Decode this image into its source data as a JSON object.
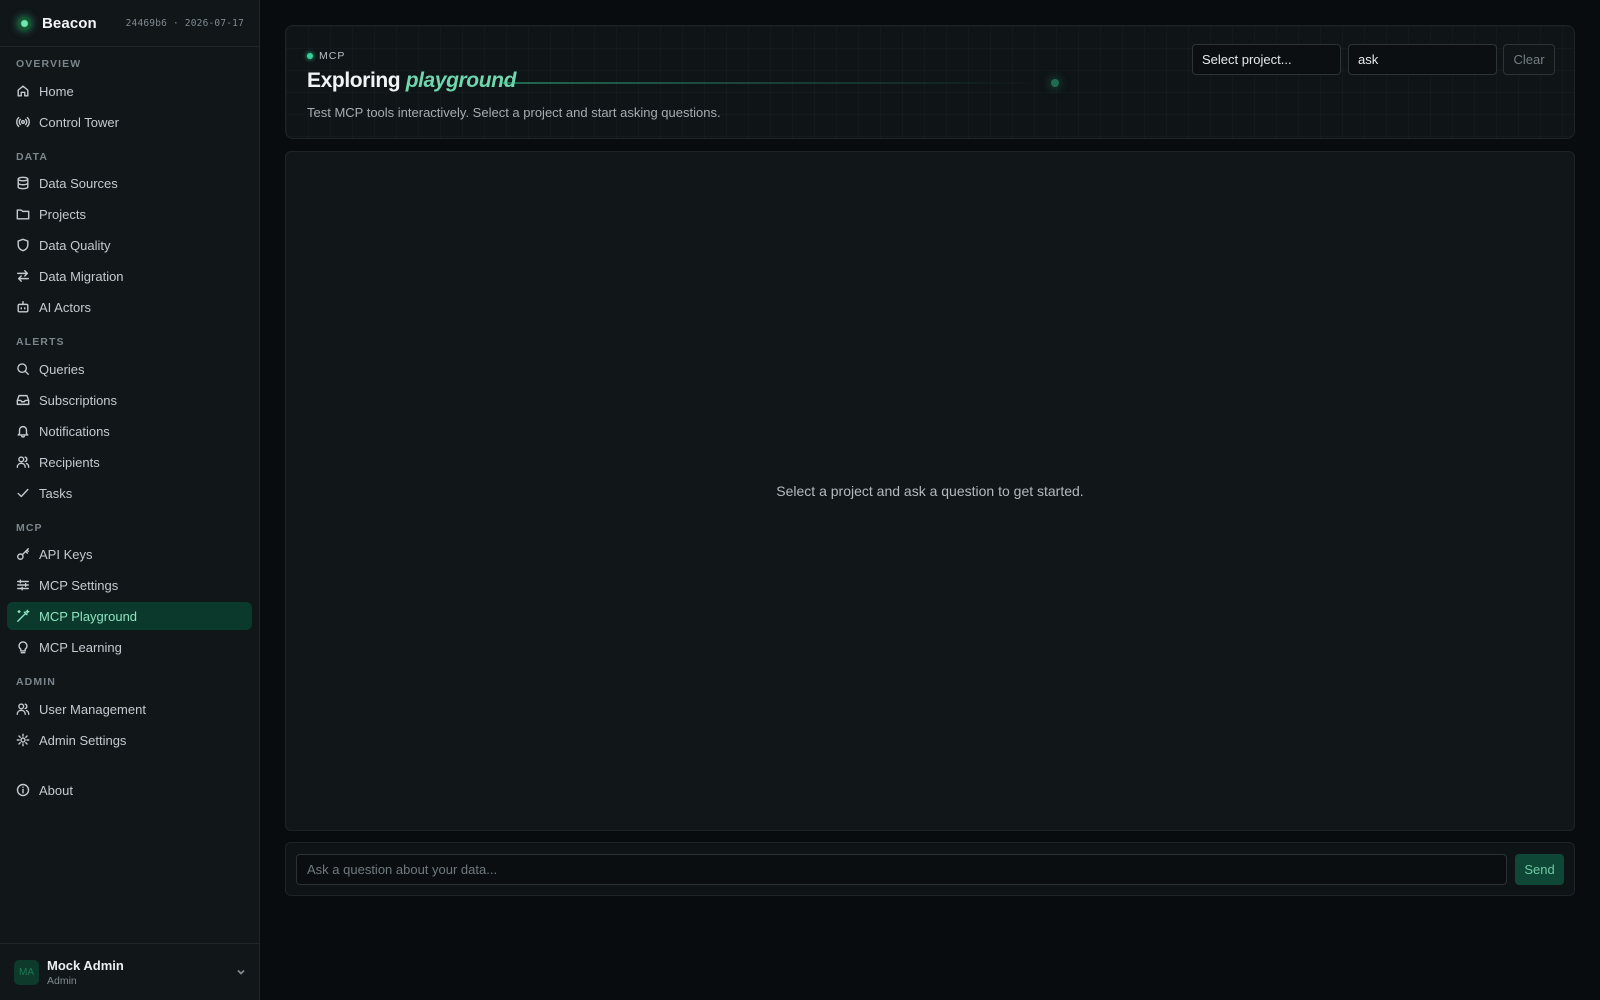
{
  "brand": {
    "name": "Beacon",
    "meta": "24469b6 · 2026-07-17"
  },
  "sidebar": {
    "sections": [
      {
        "label": "OVERVIEW",
        "items": [
          {
            "label": "Home",
            "icon": "home-icon"
          },
          {
            "label": "Control Tower",
            "icon": "broadcast-icon"
          }
        ]
      },
      {
        "label": "DATA",
        "items": [
          {
            "label": "Data Sources",
            "icon": "database-icon"
          },
          {
            "label": "Projects",
            "icon": "folder-icon"
          },
          {
            "label": "Data Quality",
            "icon": "shield-icon"
          },
          {
            "label": "Data Migration",
            "icon": "arrows-swap-icon"
          },
          {
            "label": "AI Actors",
            "icon": "robot-icon"
          }
        ]
      },
      {
        "label": "ALERTS",
        "items": [
          {
            "label": "Queries",
            "icon": "search-icon"
          },
          {
            "label": "Subscriptions",
            "icon": "inbox-icon"
          },
          {
            "label": "Notifications",
            "icon": "bell-icon"
          },
          {
            "label": "Recipients",
            "icon": "users-icon"
          },
          {
            "label": "Tasks",
            "icon": "check-icon"
          }
        ]
      },
      {
        "label": "MCP",
        "items": [
          {
            "label": "API Keys",
            "icon": "key-icon"
          },
          {
            "label": "MCP Settings",
            "icon": "sliders-icon"
          },
          {
            "label": "MCP Playground",
            "icon": "wand-icon",
            "active": true
          },
          {
            "label": "MCP Learning",
            "icon": "lightbulb-icon"
          }
        ]
      },
      {
        "label": "ADMIN",
        "items": [
          {
            "label": "User Management",
            "icon": "users-icon"
          },
          {
            "label": "Admin Settings",
            "icon": "gear-icon"
          }
        ]
      }
    ],
    "about": {
      "label": "About",
      "icon": "info-icon"
    }
  },
  "user": {
    "initials": "MA",
    "name": "Mock Admin",
    "role": "Admin"
  },
  "header": {
    "kicker": "MCP",
    "title_prefix": "Exploring",
    "title_emphasis": "playground",
    "subtitle": "Test MCP tools interactively. Select a project and start asking questions.",
    "project_select": "Select project...",
    "mode_input": "ask",
    "clear_label": "Clear"
  },
  "main": {
    "empty_message": "Select a project and ask a question to get started."
  },
  "composer": {
    "placeholder": "Ask a question about your data...",
    "send_label": "Send"
  },
  "colors": {
    "accent": "#34d399",
    "active_bg": "#0b3a2c",
    "background": "#080c0f"
  }
}
